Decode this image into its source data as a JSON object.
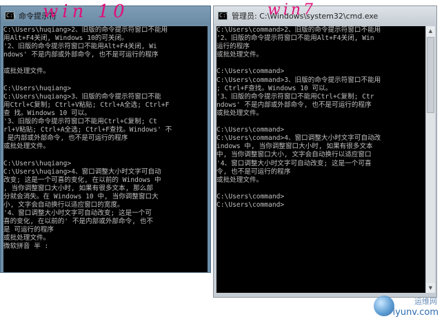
{
  "annotations": {
    "left": "win 10",
    "right": "win7"
  },
  "left_window": {
    "title": "命令提示符",
    "lines": [
      "C:\\Users\\huqiang>2、旧版的命令提示符窗口不能用",
      "用Alt+F4关闭, Windows 10的可关闭。",
      "'2、旧版的命令提示符窗口不能用Alt+F4关闭, Wi",
      "ndows' 不是内部或外部命令, 也不是可运行的程序",
      "",
      "或批处理文件。",
      "",
      "C:\\Users\\huqiang>",
      "C:\\Users\\huqiang>3、旧版的命令提示符窗口不能",
      "用Ctrl+C复制; Ctrl+V粘贴; Ctrl+A全选; Ctrl+F",
      "查 找。Windows 10 可以。",
      "'3、旧版的命令提示符窗口不能用Ctrl+C复制; Ct",
      "rl+V粘贴; Ctrl+A全选; Ctrl+F查找。Windows' 不",
      " 是内部或外部命令, 也不是可运行的程序",
      "或批处理文件。",
      "",
      "C:\\Users\\huqiang>",
      "C:\\Users\\huqiang>4、窗口调整大小时文字可自动",
      "改变; 这是一个可喜的变化, 在以前的 Windows 中",
      ", 当你调整窗口大小时, 如果有很多文本, 那么部",
      "分就会消失。在 Windows 10 中, 当你调整窗口大",
      "小, 文字会自动换行以适应窗口的宽度。",
      "'4、窗口调整大小时文字可自动改变; 这是一个可",
      "喜的变化, 在以前的' 不是内部或外部命令, 也不",
      "是 可运行的程序",
      "或批处理文件。",
      "微软拼音 半 :"
    ]
  },
  "right_window": {
    "title": "管理员: C:\\Windows\\system32\\cmd.exe",
    "lines": [
      "C:\\Users\\command>2、旧版的命令提示符窗口不能用",
      "'2、旧版的命令提示符窗口不能用Alt+F4关闭, Win",
      "运行的程序",
      "或批处理文件。",
      "",
      "C:\\Users\\command>",
      "C:\\Users\\command>3、旧版的命令提示符窗口不能用",
      "; Ctrl+F查找。Windows 10 可以。",
      "'3、旧版的命令提示符窗口不能用Ctrl+C复制; Ctr",
      "ndows' 不是内部或外部命令, 也不是可运行的程序",
      "或批处理文件。",
      "",
      "C:\\Users\\command>",
      "C:\\Users\\command>4、窗口调整大小时文字可自动改",
      "indows 中, 当你调整窗口大小时, 如果有很多文本",
      "中, 当你调整窗口大小, 文字会自动换行以适应窗口",
      "'4、窗口调整大小时文字可自动改变; 这是一个可喜",
      "令, 也不是可运行的程序",
      "或批处理文件。",
      "",
      "C:\\Users\\command>",
      "C:\\Users\\command>"
    ]
  },
  "watermark": {
    "text": "iyunv.com",
    "cn": "运维网"
  }
}
